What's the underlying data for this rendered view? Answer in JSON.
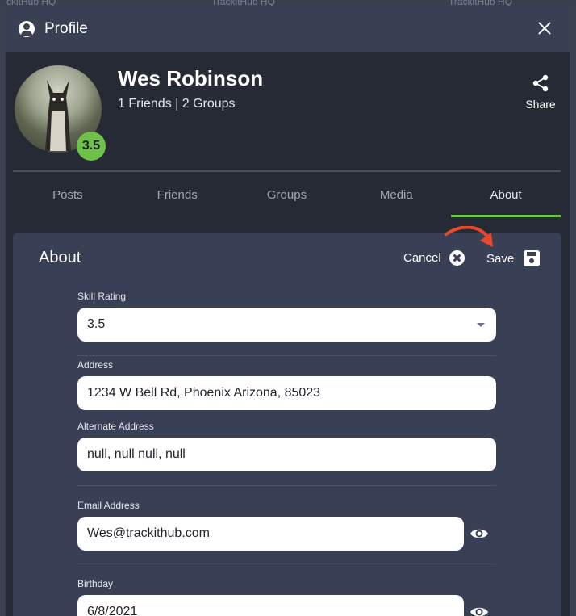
{
  "background": {
    "tabs": [
      "ckitHub HQ",
      "TrackitHub HQ",
      "TrackitHub HQ"
    ]
  },
  "modal": {
    "title": "Profile",
    "title_icon": "account-circle-icon",
    "close_icon": "close-icon"
  },
  "profile": {
    "name": "Wes Robinson",
    "stats": "1 Friends | 2 Groups",
    "rating": "3.5",
    "share_label": "Share"
  },
  "tabs": [
    {
      "label": "Posts"
    },
    {
      "label": "Friends"
    },
    {
      "label": "Groups"
    },
    {
      "label": "Media"
    },
    {
      "label": "About",
      "active": true
    }
  ],
  "about": {
    "title": "About",
    "cancel_label": "Cancel",
    "save_label": "Save",
    "fields": {
      "skill_rating": {
        "label": "Skill Rating",
        "value": "3.5"
      },
      "address": {
        "label": "Address",
        "value": "1234 W Bell Rd, Phoenix Arizona, 85023"
      },
      "alternate_address": {
        "label": "Alternate Address",
        "value": "null, null null, null"
      },
      "email": {
        "label": "Email Address",
        "value": "Wes@trackithub.com"
      },
      "birthday": {
        "label": "Birthday",
        "value": "6/8/2021"
      }
    }
  },
  "colors": {
    "accent": "#6ec24a",
    "arrow": "#e8492b"
  }
}
